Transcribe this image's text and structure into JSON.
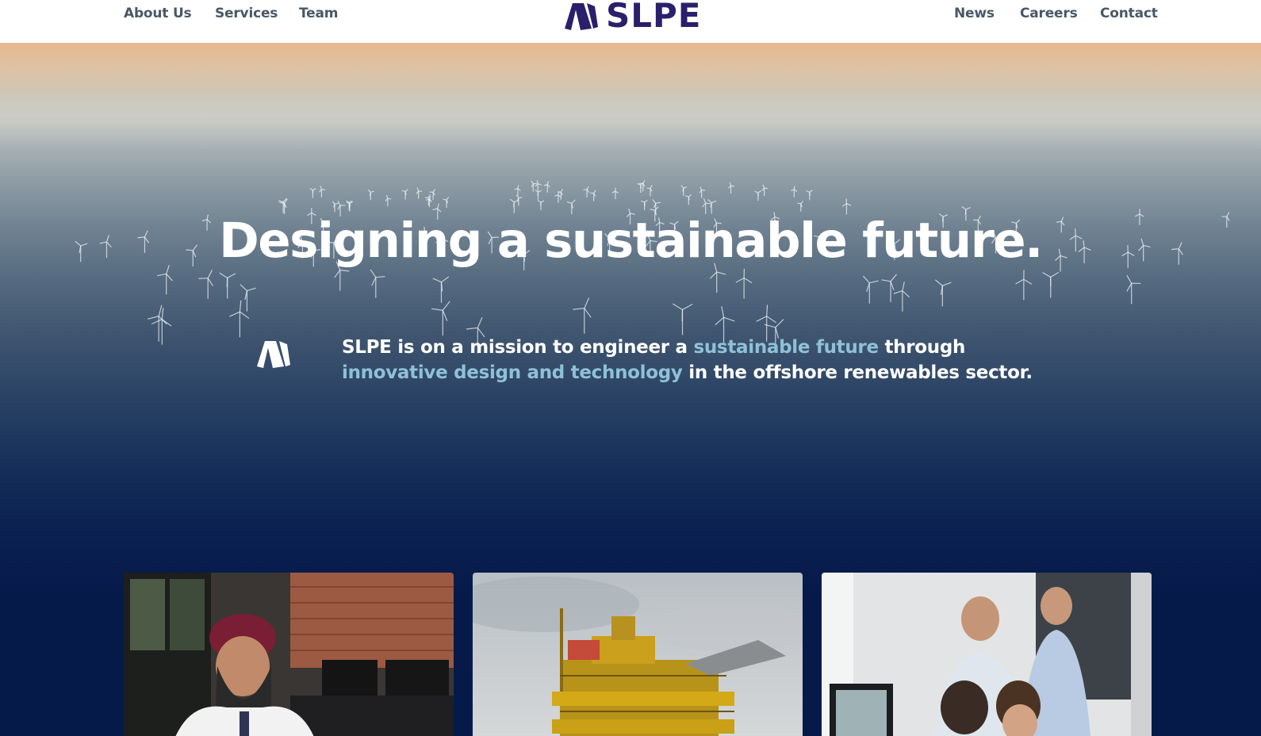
{
  "header": {
    "nav_left": [
      "About Us",
      "Services",
      "Team"
    ],
    "nav_right": [
      "News",
      "Careers",
      "Contact"
    ],
    "logo_text": "SLPE",
    "logo_icon": "slpe-sail-logo-icon",
    "brand_color": "#2a1f6b"
  },
  "hero": {
    "title": "Designing a sustainable future.",
    "mission_icon": "slpe-sail-logo-icon",
    "mission": {
      "part1": "SLPE is on a mission to engineer a ",
      "highlight1": "sustainable future",
      "part2": " through",
      "highlight2": "innovative design and technology",
      "part3": " in the offshore renewables sector."
    },
    "highlight_color": "#8fc1d8",
    "background_color": "#061a4a"
  },
  "cards": [
    {
      "image": "engineer-at-desk-photo"
    },
    {
      "image": "offshore-platform-photo"
    },
    {
      "image": "engineers-meeting-photo"
    }
  ]
}
